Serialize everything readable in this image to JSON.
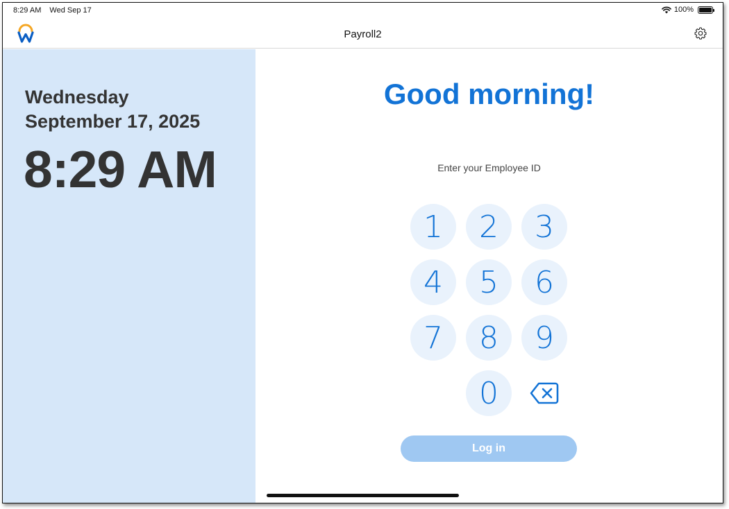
{
  "status_bar": {
    "time": "8:29 AM",
    "date": "Wed Sep 17",
    "wifi_icon": "wifi-icon",
    "battery_percent": "100%",
    "battery_level": 1.0
  },
  "nav": {
    "logo_icon": "workday-logo",
    "title": "Payroll2",
    "settings_icon": "gear-icon"
  },
  "clock_panel": {
    "weekday": "Wednesday",
    "date": "September 17, 2025",
    "time": "8:29 AM"
  },
  "main": {
    "greeting": "Good morning!",
    "prompt": "Enter your Employee ID",
    "keys": [
      "1",
      "2",
      "3",
      "4",
      "5",
      "6",
      "7",
      "8",
      "9",
      "0"
    ],
    "backspace_icon": "backspace-icon",
    "login_label": "Log in"
  },
  "colors": {
    "accent": "#1273d6",
    "panel_bg": "#d6e7f9",
    "key_bg": "#e9f2fc",
    "login_disabled": "#9fc8f2"
  }
}
